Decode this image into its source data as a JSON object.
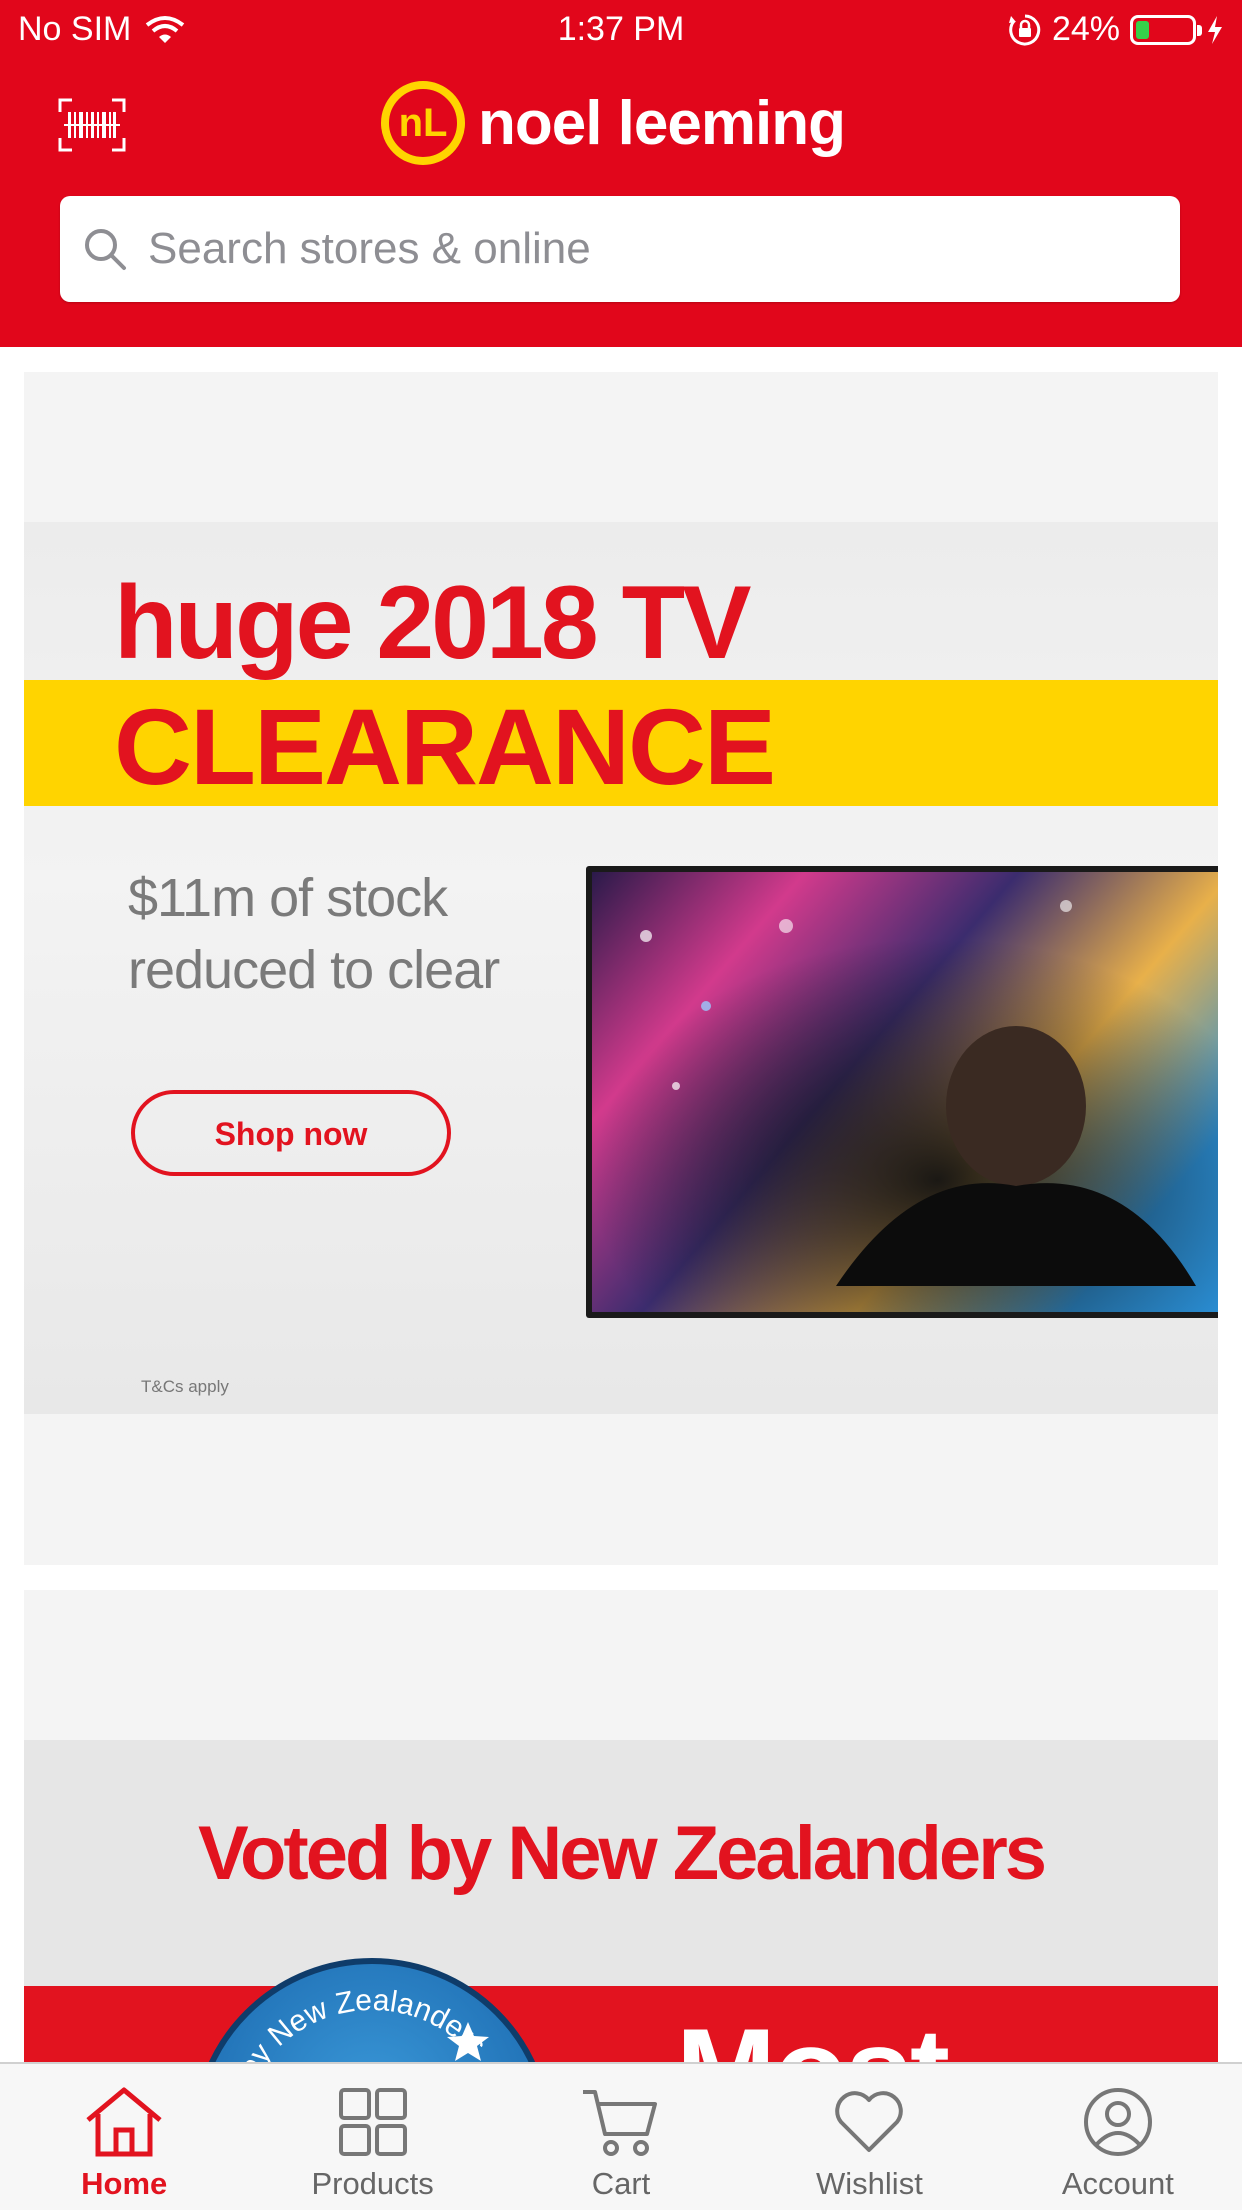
{
  "status_bar": {
    "carrier": "No SIM",
    "time": "1:37 PM",
    "battery_percent": "24%",
    "battery_level": 0.24,
    "icons": [
      "wifi-icon",
      "orientation-lock-icon",
      "battery-icon",
      "charging-icon"
    ]
  },
  "header": {
    "brand_name": "noel leeming",
    "logo_monogram": "nL",
    "barcode_icon": "barcode-scanner-icon",
    "search": {
      "placeholder": "Search stores & online",
      "value": ""
    },
    "colors": {
      "brand_red": "#e1061b",
      "logo_yellow": "#ffd400"
    }
  },
  "promo_tv": {
    "headline": "huge 2018 TV",
    "subhead": "CLEARANCE",
    "body": "$11m of stock reduced to clear",
    "cta_label": "Shop now",
    "terms": "T&Cs apply"
  },
  "promo_voted": {
    "headline": "Voted by New Zealanders",
    "badge_text": "by New Zealanders",
    "banner_text": "Most"
  },
  "tabbar": {
    "tabs": [
      {
        "label": "Home",
        "icon": "home-icon",
        "active": true
      },
      {
        "label": "Products",
        "icon": "grid-icon",
        "active": false
      },
      {
        "label": "Cart",
        "icon": "cart-icon",
        "active": false
      },
      {
        "label": "Wishlist",
        "icon": "heart-icon",
        "active": false
      },
      {
        "label": "Account",
        "icon": "account-icon",
        "active": false
      }
    ]
  }
}
